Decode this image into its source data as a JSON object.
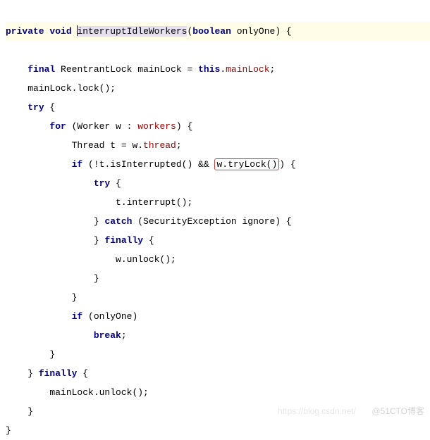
{
  "line1": {
    "kw_private": "private",
    "kw_void": "void",
    "method_name": "interruptIdleWorkers",
    "paren_open": "(",
    "kw_boolean": "boolean",
    "param": " onlyOne)",
    "brace": " {"
  },
  "l2": {
    "indent": "    ",
    "kw_final": "final",
    "type": " ReentrantLock ",
    "var": "mainLock",
    "eq": " = ",
    "kw_this": "this",
    "dot": ".",
    "member": "mainLock",
    "semi": ";"
  },
  "l3": {
    "indent": "    ",
    "text": "mainLock.",
    "call": "lock",
    "tail": "();"
  },
  "l4": {
    "indent": "    ",
    "kw_try": "try",
    "brace": " {"
  },
  "l5": {
    "indent": "        ",
    "kw_for": "for",
    "paren": " (Worker w : ",
    "member": "workers",
    "tail": ") {"
  },
  "l6": {
    "indent": "            ",
    "text1": "Thread t = w.",
    "member": "thread",
    "semi": ";"
  },
  "l7": {
    "indent": "            ",
    "kw_if": "if",
    "text1": " (!t.isInterrupted() && ",
    "boxed": "w.tryLock()",
    "tail": ") {"
  },
  "l8": {
    "indent": "                ",
    "kw_try": "try",
    "brace": " {"
  },
  "l9": {
    "indent": "                    ",
    "text": "t.interrupt();"
  },
  "l10": {
    "indent": "                ",
    "close": "} ",
    "kw_catch": "catch",
    "args": " (SecurityException ignore) {"
  },
  "l11": {
    "indent": "                ",
    "close": "} ",
    "kw_finally": "finally",
    "brace": " {"
  },
  "l12": {
    "indent": "                    ",
    "text": "w.unlock();"
  },
  "l13": {
    "indent": "                ",
    "close": "}"
  },
  "l14": {
    "indent": "            ",
    "close": "}"
  },
  "l15": {
    "indent": "            ",
    "kw_if": "if",
    "text": " (onlyOne)"
  },
  "l16": {
    "indent": "                ",
    "kw_break": "break",
    "semi": ";"
  },
  "l17": {
    "indent": "        ",
    "close": "}"
  },
  "l18": {
    "indent": "    ",
    "close": "} ",
    "kw_finally": "finally",
    "brace": " {"
  },
  "l19": {
    "indent": "        ",
    "text": "mainLock.unlock();"
  },
  "l20": {
    "indent": "    ",
    "close": "}"
  },
  "l21": {
    "close": "}"
  },
  "watermark1": "https://blog.csdn.net/",
  "watermark2": "@51CTO博客"
}
